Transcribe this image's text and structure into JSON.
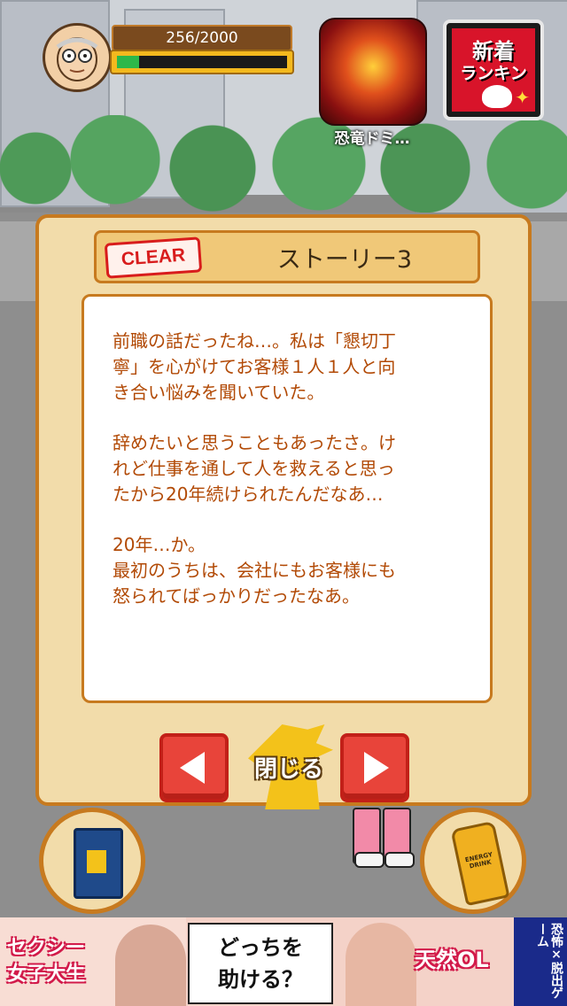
{
  "hud": {
    "avatar_icon": "old-man-face-icon",
    "exp_text": "256/2000",
    "exp_progress": 0.128,
    "promo_label": "恐竜ドミ…",
    "ranking_line1": "新着",
    "ranking_line2": "ランキング"
  },
  "story": {
    "badge": "CLEAR",
    "title": "ストーリー3",
    "paragraphs": [
      "前職の話だったね…。私は「懇切丁\n寧」を心がけてお客様１人１人と向\nき合い悩みを聞いていた。",
      "辞めたいと思うこともあったさ。け\nれど仕事を通して人を救えると思っ\nたから20年続けられたんだなあ…",
      "20年…か。\n最初のうちは、会社にもお客様にも\n怒られてばっかりだったなあ。"
    ],
    "close_label": "閉じる"
  },
  "items": {
    "book_icon": "blue-book-icon",
    "drink_icon": "energy-drink-icon",
    "drink_label": "ENERGY DRINK"
  },
  "ad": {
    "left_text": "セクシー\n女子大生",
    "center_text": "どっちを\n助ける？",
    "right_text": "天然OL",
    "strip_text": "恐怖×脱出ゲーム"
  },
  "colors": {
    "panel_border": "#c77a1f",
    "story_text": "#b24a06",
    "nav_button": "#e8443a",
    "exp_fill": "#2db84a"
  }
}
